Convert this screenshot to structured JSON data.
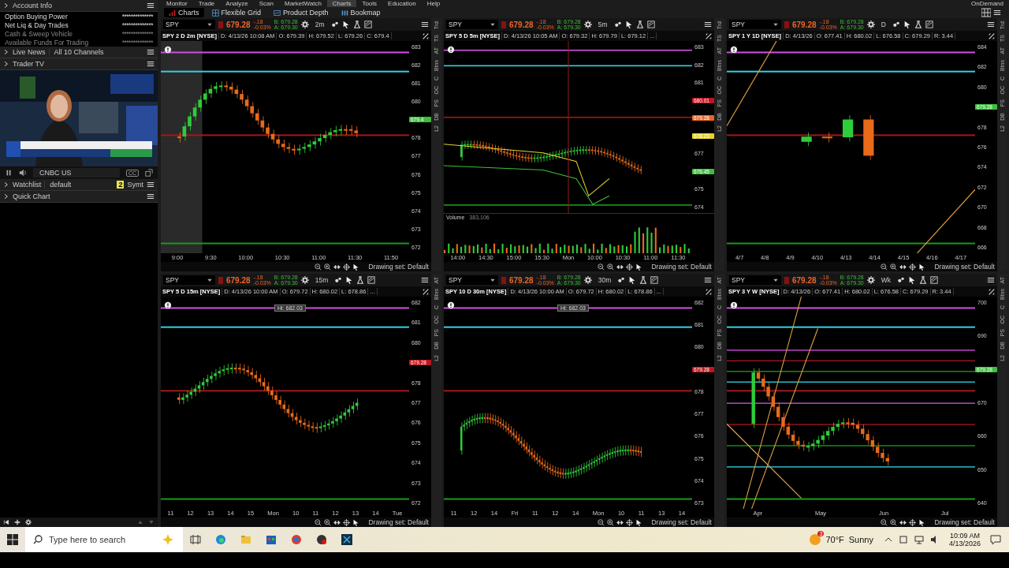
{
  "menu": {
    "tabs": [
      {
        "label": "Monitor",
        "selected": false
      },
      {
        "label": "Trade",
        "selected": false
      },
      {
        "label": "Analyze",
        "selected": false
      },
      {
        "label": "Scan",
        "selected": false
      },
      {
        "label": "MarketWatch",
        "selected": false
      },
      {
        "label": "Charts",
        "selected": true
      },
      {
        "label": "Tools",
        "selected": false
      },
      {
        "label": "Education",
        "selected": false
      },
      {
        "label": "Help",
        "selected": false
      }
    ],
    "ondemand": "OnDemand"
  },
  "subtabs": [
    {
      "label": "Charts",
      "selected": true
    },
    {
      "label": "Flexible Grid",
      "selected": false
    },
    {
      "label": "Product Depth",
      "selected": false
    },
    {
      "label": "Bookmap",
      "selected": false
    }
  ],
  "account": {
    "title": "Account Info",
    "rows": [
      {
        "label": "Option Buying Power",
        "value": "**************",
        "dimmed": false
      },
      {
        "label": "Net Liq & Day Trades",
        "value": "**************",
        "dimmed": false
      },
      {
        "label": "Cash & Sweep Vehicle",
        "value": "**************",
        "dimmed": true
      },
      {
        "label": "Available Funds For Trading",
        "value": "**************",
        "dimmed": true
      }
    ]
  },
  "news": {
    "title": "Live News",
    "channel": "All 10 Channels"
  },
  "tv": {
    "title": "Trader TV",
    "channel": "CNBC US",
    "cc": "CC"
  },
  "watchlist": {
    "title": "Watchlist",
    "name": "default",
    "badge": "2",
    "column": "Symt"
  },
  "quick_chart": {
    "title": "Quick Chart"
  },
  "charts": [
    {
      "symbol": "SPY",
      "price": "679.28",
      "change": "-.18",
      "change_pct": "-0.03%",
      "bid": "B: 679.28",
      "ask": "A: 679.30",
      "timeframe": "2m",
      "title": "SPY 2 D 2m [NYSE]",
      "info": [
        "D: 4/13/26 10:08 AM",
        "O: 679.39",
        "H: 679.52",
        "L: 679.26",
        "C: 679.4"
      ],
      "yticks": [
        {
          "label": "683"
        },
        {
          "label": "682"
        },
        {
          "label": "681"
        },
        {
          "label": "680"
        },
        {
          "label": "679.4",
          "kind": "tag",
          "color": "#3cbf3c"
        },
        {
          "label": "678"
        },
        {
          "label": "677"
        },
        {
          "label": "676"
        },
        {
          "label": "675"
        },
        {
          "label": "674"
        },
        {
          "label": "673"
        },
        {
          "label": "672"
        }
      ],
      "xticks": [
        "9:00",
        "9:30",
        "10:00",
        "10:30",
        "11:00",
        "11:30",
        "11:50"
      ],
      "drawing_set": "Drawing set: Default",
      "side_tabs": [
        "Trd",
        "TS",
        "AT",
        "Btns",
        "C",
        "OC",
        "PS",
        "DB",
        "L2"
      ]
    },
    {
      "symbol": "SPY",
      "price": "679.28",
      "change": "-.18",
      "change_pct": "-0.03%",
      "bid": "B: 679.28",
      "ask": "A: 679.30",
      "timeframe": "5m",
      "title": "SPY 5 D 5m [NYSE]",
      "info": [
        "D: 4/13/26 10:05 AM",
        "O: 679.32",
        "H: 679.79",
        "L: 679.12",
        "..."
      ],
      "yticks": [
        {
          "label": "683"
        },
        {
          "label": "682"
        },
        {
          "label": "681"
        },
        {
          "label": "680.01",
          "kind": "tag",
          "color": "#c0141e"
        },
        {
          "label": "679.28",
          "kind": "tag",
          "color": "#e8652a"
        },
        {
          "label": "678.23",
          "kind": "tag",
          "color": "#e6d32a"
        },
        {
          "label": "677"
        },
        {
          "label": "676.45",
          "kind": "tag",
          "color": "#3cbf3c"
        },
        {
          "label": "675"
        },
        {
          "label": "674"
        }
      ],
      "volume": {
        "label": "Volume",
        "value": "383,106"
      },
      "xticks": [
        "14:00",
        "14:30",
        "15:00",
        "15:30",
        "Mon",
        "10:00",
        "10:30",
        "11:00",
        "11:30"
      ],
      "drawing_set": "Drawing set: Default",
      "side_tabs": [
        "Trd",
        "TS",
        "AT",
        "Btns",
        "C",
        "OC",
        "PS",
        "DB",
        "L2"
      ]
    },
    {
      "symbol": "SPY",
      "price": "679.28",
      "change": "-.18",
      "change_pct": "-0.03%",
      "bid": "B: 679.28",
      "ask": "A: 679.30",
      "timeframe": "D",
      "title": "SPY 1 Y 1D [NYSE]",
      "info": [
        "D: 4/13/26",
        "O: 677.41",
        "H: 680.02",
        "L: 676.58",
        "C: 679.29",
        "R: 3.44"
      ],
      "yticks": [
        {
          "label": "684"
        },
        {
          "label": "682"
        },
        {
          "label": "680"
        },
        {
          "label": "679.28",
          "kind": "tag",
          "color": "#3cbf3c"
        },
        {
          "label": "678"
        },
        {
          "label": "676"
        },
        {
          "label": "674"
        },
        {
          "label": "672"
        },
        {
          "label": "670"
        },
        {
          "label": "668"
        },
        {
          "label": "666"
        }
      ],
      "xticks": [
        "4/7",
        "4/8",
        "4/9",
        "4/10",
        "4/13",
        "4/14",
        "4/15",
        "4/16",
        "4/17"
      ],
      "drawing_set": "Drawing set: Default",
      "side_tabs": [
        "Trd",
        "TS",
        "AT",
        "Btns",
        "C",
        "OC",
        "PS",
        "DB",
        "L2"
      ]
    },
    {
      "symbol": "SPY",
      "price": "679.28",
      "change": "-.18",
      "change_pct": "-0.03%",
      "bid": "B: 679.28",
      "ask": "A: 679.30",
      "timeframe": "15m",
      "title": "SPY 5 D 15m [NYSE]",
      "info": [
        "D: 4/13/26 10:00 AM",
        "O: 679.72",
        "H: 680.02",
        "L: 678.86",
        "..."
      ],
      "high_label": "Hi: 682.03",
      "yticks": [
        {
          "label": "682"
        },
        {
          "label": "681"
        },
        {
          "label": "680"
        },
        {
          "label": "679.28",
          "kind": "tag",
          "color": "#c0141e"
        },
        {
          "label": "678"
        },
        {
          "label": "677"
        },
        {
          "label": "676"
        },
        {
          "label": "675"
        },
        {
          "label": "674"
        },
        {
          "label": "673"
        },
        {
          "label": "672"
        }
      ],
      "xticks": [
        "11",
        "12",
        "13",
        "14",
        "15",
        "Mon",
        "10",
        "11",
        "12",
        "13",
        "14",
        "Tue"
      ],
      "drawing_set": "Drawing set: Default",
      "side_tabs": [
        "AT",
        "Btns",
        "C",
        "OC",
        "PS",
        "DB",
        "L2"
      ]
    },
    {
      "symbol": "SPY",
      "price": "679.28",
      "change": "-.18",
      "change_pct": "-0.03%",
      "bid": "B: 679.28",
      "ask": "A: 679.30",
      "timeframe": "30m",
      "title": "SPY 10 D 30m [NYSE]",
      "info": [
        "D: 4/13/26 10:00 AM",
        "O: 679.72",
        "H: 680.02",
        "L: 678.86",
        "..."
      ],
      "high_label": "Hi: 682.03",
      "yticks": [
        {
          "label": "682"
        },
        {
          "label": "681"
        },
        {
          "label": "680"
        },
        {
          "label": "679.28",
          "kind": "tag",
          "color": "#c0141e"
        },
        {
          "label": "678"
        },
        {
          "label": "677"
        },
        {
          "label": "676"
        },
        {
          "label": "675"
        },
        {
          "label": "674"
        },
        {
          "label": "673"
        }
      ],
      "xticks": [
        "11",
        "12",
        "14",
        "Fri",
        "11",
        "12",
        "14",
        "Mon",
        "10",
        "11",
        "13",
        "14"
      ],
      "drawing_set": "Drawing set: Default",
      "side_tabs": [
        "AT",
        "Btns",
        "C",
        "OC",
        "PS",
        "DB",
        "L2"
      ]
    },
    {
      "symbol": "SPY",
      "price": "679.28",
      "change": "-.18",
      "change_pct": "-0.03%",
      "bid": "B: 679.28",
      "ask": "A: 679.30",
      "timeframe": "Wk",
      "title": "SPY 3 Y W [NYSE]",
      "info": [
        "D: 4/13/26",
        "O: 677.41",
        "H: 680.02",
        "L: 676.58",
        "C: 679.29",
        "R: 3.44"
      ],
      "yticks": [
        {
          "label": "700"
        },
        {
          "label": "690"
        },
        {
          "label": "679.28",
          "kind": "tag",
          "color": "#3cbf3c"
        },
        {
          "label": "670"
        },
        {
          "label": "660"
        },
        {
          "label": "650"
        },
        {
          "label": "640"
        }
      ],
      "xticks": [
        "Apr",
        "May",
        "Jun",
        "Jul"
      ],
      "drawing_set": "Drawing set: Default",
      "side_tabs": [
        "AT",
        "Btns",
        "C",
        "OC",
        "PS",
        "DB",
        "L2"
      ]
    }
  ],
  "taskbar": {
    "search_placeholder": "Type here to search",
    "weather_badge": "3",
    "temperature": "70°F",
    "weather": "Sunny",
    "time": "10:09 AM",
    "date": "4/13/2026"
  }
}
